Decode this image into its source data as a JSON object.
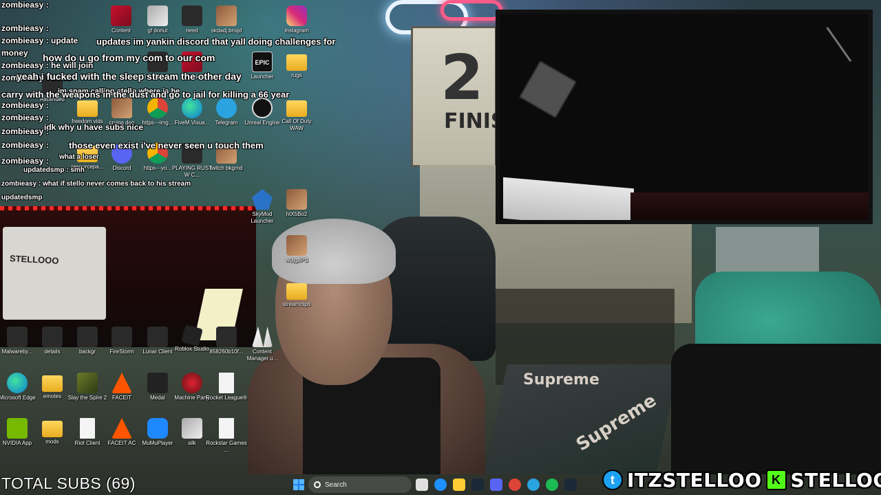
{
  "overlay": {
    "total_subs": "TOTAL SUBS (69)",
    "twitter_handle": "ITZSTELLOO",
    "kick_handle": "STELLOOO"
  },
  "background": {
    "poster_number": "2",
    "poster_word": "FINISH",
    "rug_word_1": "Supreme",
    "rug_word_2": "Supreme",
    "cam_poster_text": "STELLOOO"
  },
  "chat": [
    {
      "text": "zombieasy :"
    },
    {
      "text": "zombieasy :"
    },
    {
      "text": "zombieasy : update"
    },
    {
      "text": "zombieasy : he will join"
    },
    {
      "text": "zombieasy : same"
    },
    {
      "text": "zombieasy :"
    },
    {
      "text": "zombieasy :"
    },
    {
      "text": "zombieasy :"
    },
    {
      "text": "zombieasy :"
    },
    {
      "text": "zombieasy :"
    },
    {
      "text": "updatedsmp : smh"
    },
    {
      "text": "zombieasy : what if stello never comes back to his stream"
    },
    {
      "text": "updatedsmp"
    },
    {
      "text": "updates im yankin discord that yall doing challenges for"
    },
    {
      "text": "money"
    },
    {
      "text": "how do u go from my com to our com"
    },
    {
      "text": "yeah i fucked with the sleep stream the other day"
    },
    {
      "text": "im spam calling stello where is he"
    },
    {
      "text": "carry with the weapons in the dust and go to jail for killing a 66 year"
    },
    {
      "text": "idk why u have subs nice"
    },
    {
      "text": "those even exist i've never seen u touch them"
    },
    {
      "text": "what a loser"
    }
  ],
  "desktop_icons": [
    {
      "label": "Content",
      "kind": "red"
    },
    {
      "label": "gf donut",
      "kind": "glass"
    },
    {
      "label": "need",
      "kind": "dark"
    },
    {
      "label": "skdadj.bnsjd",
      "kind": "photo"
    },
    {
      "label": "Instagram",
      "kind": "insta"
    },
    {
      "label": "Track Your ...",
      "kind": "dark"
    },
    {
      "label": "Browser",
      "kind": "red"
    },
    {
      "label": "Launcher",
      "kind": "epic",
      "glyph": "EPIC"
    },
    {
      "label": "rugs",
      "kind": "folder"
    },
    {
      "label": "Ascended",
      "kind": "dark"
    },
    {
      "label": "freedom vids",
      "kind": "folder"
    },
    {
      "label": "crying dog",
      "kind": "photo"
    },
    {
      "label": "https---img...",
      "kind": "chrome"
    },
    {
      "label": "FiveM.Visua...",
      "kind": "edge"
    },
    {
      "label": "Telegram",
      "kind": "tele"
    },
    {
      "label": "Unreal Engine",
      "kind": "unreal"
    },
    {
      "label": "Call Of Duty WAW",
      "kind": "folder"
    },
    {
      "label": "Discord",
      "kind": "discord"
    },
    {
      "label": "https---yo...",
      "kind": "chrome"
    },
    {
      "label": "PLAYING RUST W C...",
      "kind": "dark"
    },
    {
      "label": "twitch bkgrnd",
      "kind": "photo"
    },
    {
      "label": "resourcepa...",
      "kind": "folder"
    },
    {
      "label": "SkyMod Launcher",
      "kind": "wolf"
    },
    {
      "label": "htX5Bo2",
      "kind": "photo"
    },
    {
      "label": "wUjg8PS",
      "kind": "photo"
    },
    {
      "label": "streamclips",
      "kind": "folder"
    },
    {
      "label": "Malwareby...",
      "kind": "dark"
    },
    {
      "label": "details",
      "kind": "dark"
    },
    {
      "label": "backgr",
      "kind": "dark"
    },
    {
      "label": "FireStorm",
      "kind": "dark"
    },
    {
      "label": "Lunar Client",
      "kind": "dark"
    },
    {
      "label": "Roblox Studio",
      "kind": "roblox"
    },
    {
      "label": "858260b10f...",
      "kind": "dark"
    },
    {
      "label": "Content Manager.u...",
      "kind": "content"
    },
    {
      "label": "Microsoft Edge",
      "kind": "edge"
    },
    {
      "label": "emotes",
      "kind": "folder"
    },
    {
      "label": "Slay the Spire 2",
      "kind": "slay"
    },
    {
      "label": "FACEIT",
      "kind": "faceit"
    },
    {
      "label": "Medal",
      "kind": "medal"
    },
    {
      "label": "Machine Party",
      "kind": "machine"
    },
    {
      "label": "Rocket League®",
      "kind": "doc"
    },
    {
      "label": "NVIDIA App",
      "kind": "nvidia"
    },
    {
      "label": "mods",
      "kind": "folder"
    },
    {
      "label": "Riot Client",
      "kind": "doc"
    },
    {
      "label": "FACEIT AC",
      "kind": "faceit"
    },
    {
      "label": "MuMuPlayer",
      "kind": "mumu"
    },
    {
      "label": "silk",
      "kind": "glass"
    },
    {
      "label": "Rockstar Games ...",
      "kind": "doc"
    }
  ],
  "taskbar": {
    "search_placeholder": "Search",
    "apps": [
      {
        "name": "start-icon"
      },
      {
        "name": "copilot-icon",
        "color": "#e0e0e0"
      },
      {
        "name": "edge-icon",
        "color": "#1e90ff"
      },
      {
        "name": "explorer-icon",
        "color": "#ffcc33"
      },
      {
        "name": "steam-icon",
        "color": "#1b2838"
      },
      {
        "name": "discord-icon",
        "color": "#5865f2"
      },
      {
        "name": "chrome-icon",
        "color": "#db4437"
      },
      {
        "name": "telegram-icon",
        "color": "#2aa3e0"
      },
      {
        "name": "spotify-icon",
        "color": "#1db954"
      },
      {
        "name": "steam-icon-2",
        "color": "#1b2838"
      }
    ]
  },
  "colors": {
    "twitter": "#1da1f2",
    "kick": "#53fc18",
    "led_red": "#ff2a2a"
  }
}
